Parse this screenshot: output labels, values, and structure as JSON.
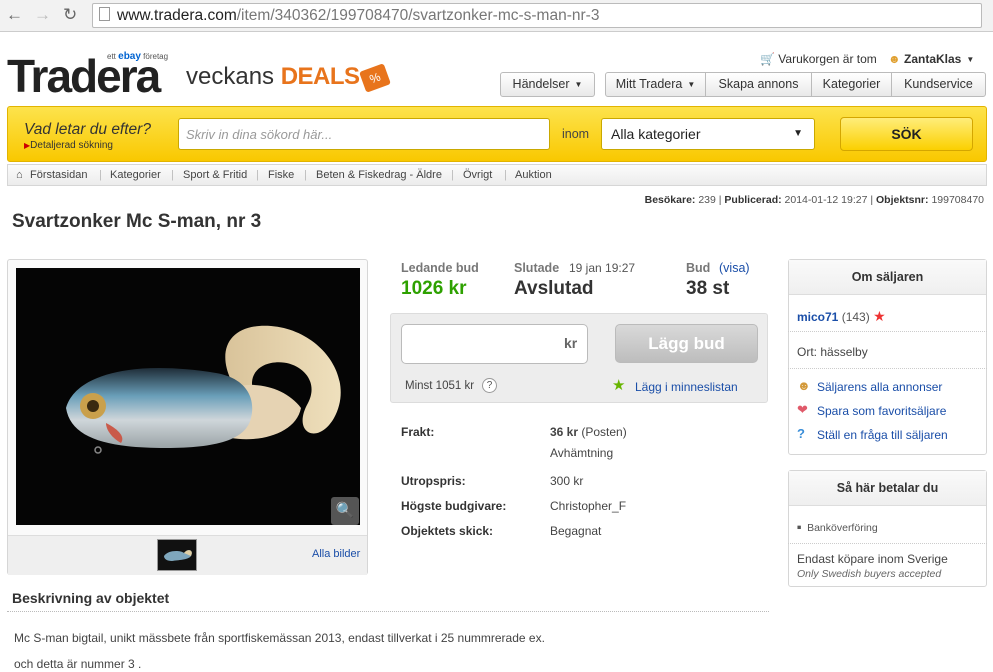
{
  "browser": {
    "url_host": "www.tradera.com",
    "url_path": "/item/340362/199708470/svartzonker-mc-s-man-nr-3"
  },
  "header": {
    "logo": "Tradera",
    "ebay_tag_pre": "ett",
    "ebay_tag_brand": "ebay",
    "ebay_tag_post": "företag",
    "deals_prefix": "veckans",
    "deals_word": "DEALS",
    "deals_badge": "%",
    "cart": "Varukorgen är tom",
    "user": "ZantaKlas",
    "nav": {
      "handelser": "Händelser",
      "mitt_tradera": "Mitt Tradera",
      "skapa": "Skapa annons",
      "kategorier": "Kategorier",
      "kundservice": "Kundservice"
    }
  },
  "search": {
    "prompt": "Vad letar du efter?",
    "detailed": "Detaljerad sökning",
    "placeholder": "Skriv in dina sökord här...",
    "inom": "inom",
    "category": "Alla kategorier",
    "button": "SÖK"
  },
  "breadcrumb": [
    "Förstasidan",
    "Kategorier",
    "Sport & Fritid",
    "Fiske",
    "Beten & Fiskedrag - Äldre",
    "Övrigt",
    "Auktion"
  ],
  "stats": {
    "visitors_label": "Besökare:",
    "visitors": "239",
    "published_label": "Publicerad:",
    "published": "2014-01-12 19:27",
    "objnr_label": "Objektsnr:",
    "objnr": "199708470"
  },
  "item": {
    "title": "Svartzonker Mc S-man, nr 3",
    "all_images": "Alla bilder"
  },
  "bid": {
    "lead_label": "Ledande bud",
    "lead_value": "1026 kr",
    "ended_label": "Slutade",
    "ended_date": "19 jan 19:27",
    "ended_value": "Avslutad",
    "bids_label": "Bud",
    "bids_visa": "(visa)",
    "bids_value": "38 st",
    "currency": "kr",
    "place_bid": "Lägg bud",
    "min_bid": "Minst 1051 kr",
    "help": "?",
    "watchlist": "Lägg i minneslistan"
  },
  "details": {
    "shipping_label": "Frakt:",
    "shipping_price": "36 kr",
    "shipping_carrier": "(Posten)",
    "pickup": "Avhämtning",
    "start_label": "Utropspris:",
    "start_value": "300 kr",
    "highest_label": "Högste budgivare:",
    "highest_value": "Christopher_F",
    "condition_label": "Objektets skick:",
    "condition_value": "Begagnat"
  },
  "seller": {
    "heading": "Om säljaren",
    "name": "mico71",
    "rating": "(143)",
    "location_label": "Ort:",
    "location": "hässelby",
    "all_listings": "Säljarens alla annonser",
    "save_favorite": "Spara som favoritsäljare",
    "ask_question": "Ställ en fråga till säljaren"
  },
  "payment": {
    "heading": "Så här betalar du",
    "method": "Banköverföring",
    "sweden_only": "Endast köpare inom Sverige",
    "sweden_only_en": "Only Swedish buyers accepted"
  },
  "description": {
    "heading": "Beskrivning av objektet",
    "line1": "Mc S-man bigtail, unikt mässbete från sportfiskemässan 2013, endast tillverkat i 25 nummrerade ex.",
    "line2": "och detta är nummer 3 ."
  }
}
